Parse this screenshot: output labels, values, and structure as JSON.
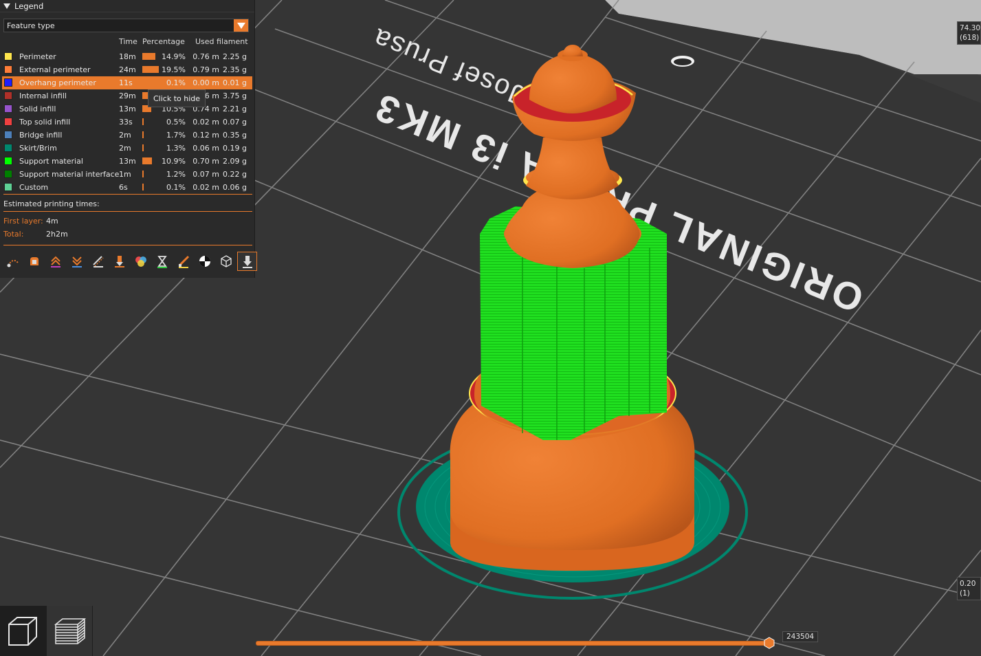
{
  "legend": {
    "title": "Legend",
    "view_type": "Feature type",
    "columns": {
      "time": "Time",
      "percentage": "Percentage",
      "used_filament": "Used filament"
    },
    "items": [
      {
        "name": "Perimeter",
        "color": "#FFE64D",
        "time": "18m",
        "percent": "14.9%",
        "length": "0.76 m",
        "weight": "2.25 g",
        "fraction": 0.149
      },
      {
        "name": "External perimeter",
        "color": "#FF7D38",
        "time": "24m",
        "percent": "19.5%",
        "length": "0.79 m",
        "weight": "2.35 g",
        "fraction": 0.195
      },
      {
        "name": "Overhang perimeter",
        "color": "#1F1FFF",
        "time": "11s",
        "percent": "0.1%",
        "length": "0.00 m",
        "weight": "0.01 g",
        "fraction": 0.001,
        "selected": true
      },
      {
        "name": "Internal infill",
        "color": "#B03029",
        "time": "29m",
        "percent": "",
        "length": ".26 m",
        "weight": "3.75 g",
        "fraction": 0.24
      },
      {
        "name": "Solid infill",
        "color": "#9654CC",
        "time": "13m",
        "percent": "10.5%",
        "length": "0.74 m",
        "weight": "2.21 g",
        "fraction": 0.105
      },
      {
        "name": "Top solid infill",
        "color": "#F04040",
        "time": "33s",
        "percent": "0.5%",
        "length": "0.02 m",
        "weight": "0.07 g",
        "fraction": 0.005
      },
      {
        "name": "Bridge infill",
        "color": "#4D80BA",
        "time": "2m",
        "percent": "1.7%",
        "length": "0.12 m",
        "weight": "0.35 g",
        "fraction": 0.017
      },
      {
        "name": "Skirt/Brim",
        "color": "#00876E",
        "time": "2m",
        "percent": "1.3%",
        "length": "0.06 m",
        "weight": "0.19 g",
        "fraction": 0.013
      },
      {
        "name": "Support material",
        "color": "#00FF00",
        "time": "13m",
        "percent": "10.9%",
        "length": "0.70 m",
        "weight": "2.09 g",
        "fraction": 0.109
      },
      {
        "name": "Support material interface",
        "color": "#008000",
        "time": "1m",
        "percent": "1.2%",
        "length": "0.07 m",
        "weight": "0.22 g",
        "fraction": 0.012
      },
      {
        "name": "Custom",
        "color": "#5ED194",
        "time": "6s",
        "percent": "0.1%",
        "length": "0.02 m",
        "weight": "0.06 g",
        "fraction": 0.001
      }
    ],
    "tooltip": "Click to hide",
    "estimated_title": "Estimated printing times:",
    "first_layer_label": "First layer:",
    "first_layer_value": "4m",
    "total_label": "Total:",
    "total_value": "2h2m",
    "toolbar_icons": [
      "travel-icon",
      "wipe-icon",
      "retractions-icon",
      "deretractions-icon",
      "seams-icon",
      "tool-changes-icon",
      "color-changes-icon",
      "pause-prints-icon",
      "custom-gcodes-icon",
      "center-of-gravity-icon",
      "shells-icon",
      "tool-marker-icon"
    ]
  },
  "vertical_slider": {
    "top_value": "74.30",
    "top_layer": "(618)",
    "bottom_value": "0.20",
    "bottom_layer": "(1)"
  },
  "horizontal_slider": {
    "value": "243504",
    "fraction": 1.0
  },
  "bed_text": {
    "line1": "ORIGINAL PRUSA i3 MK3",
    "line2": "by Josef Prusa"
  },
  "accent_color": "#E97A2C"
}
